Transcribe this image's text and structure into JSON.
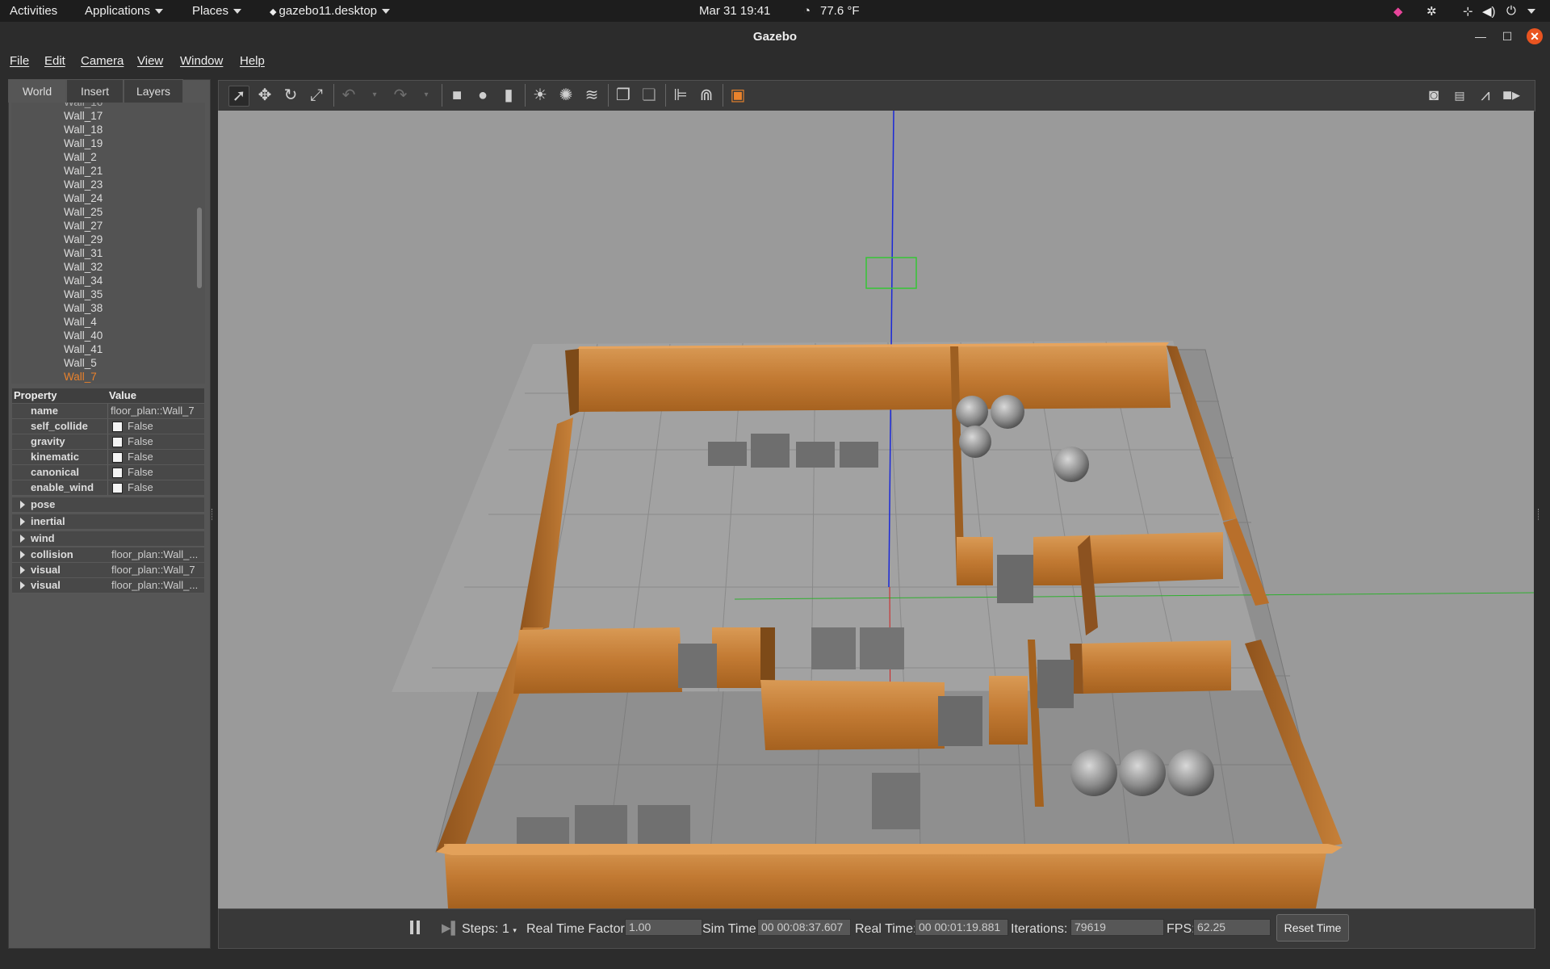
{
  "topbar": {
    "activities": "Activities",
    "applications": "Applications",
    "places": "Places",
    "app_indicator": "gazebo11.desktop",
    "clock": "Mar 31  19:41",
    "temperature": "77.6 °F"
  },
  "window": {
    "title": "Gazebo"
  },
  "menu": [
    "File",
    "Edit",
    "Camera",
    "View",
    "Window",
    "Help"
  ],
  "tabs": [
    "World",
    "Insert",
    "Layers"
  ],
  "tree_items": [
    "Wall_17",
    "Wall_18",
    "Wall_19",
    "Wall_2",
    "Wall_21",
    "Wall_23",
    "Wall_24",
    "Wall_25",
    "Wall_27",
    "Wall_29",
    "Wall_31",
    "Wall_32",
    "Wall_34",
    "Wall_35",
    "Wall_38",
    "Wall_4",
    "Wall_40",
    "Wall_41",
    "Wall_5",
    "Wall_7"
  ],
  "tree_selected": "Wall_7",
  "properties": {
    "header_property": "Property",
    "header_value": "Value",
    "rows": [
      {
        "name": "name",
        "value": "floor_plan::Wall_7"
      },
      {
        "name": "self_collide",
        "value": "False"
      },
      {
        "name": "gravity",
        "value": "False"
      },
      {
        "name": "kinematic",
        "value": "False"
      },
      {
        "name": "canonical",
        "value": "False"
      },
      {
        "name": "enable_wind",
        "value": "False"
      },
      {
        "name": "pose",
        "value": ""
      },
      {
        "name": "inertial",
        "value": ""
      },
      {
        "name": "wind",
        "value": ""
      },
      {
        "name": "collision",
        "value": "floor_plan::Wall_..."
      },
      {
        "name": "visual",
        "value": "floor_plan::Wall_7"
      },
      {
        "name": "visual",
        "value": "floor_plan::Wall_..."
      }
    ]
  },
  "status": {
    "steps_label": "Steps:",
    "steps_value": "1",
    "rtf_label": "Real Time Factor:",
    "rtf_value": "1.00",
    "sim_time_label": "Sim Time:",
    "sim_time_value": "00 00:08:37.607",
    "real_time_label": "Real Time:",
    "real_time_value": "00 00:01:19.881",
    "iterations_label": "Iterations:",
    "iterations_value": "79619",
    "fps_label": "FPS:",
    "fps_value": "62.25",
    "reset_label": "Reset Time"
  },
  "colors": {
    "wood": "#c98137",
    "floor": "#9a9a9a",
    "accent": "#e9822c"
  }
}
